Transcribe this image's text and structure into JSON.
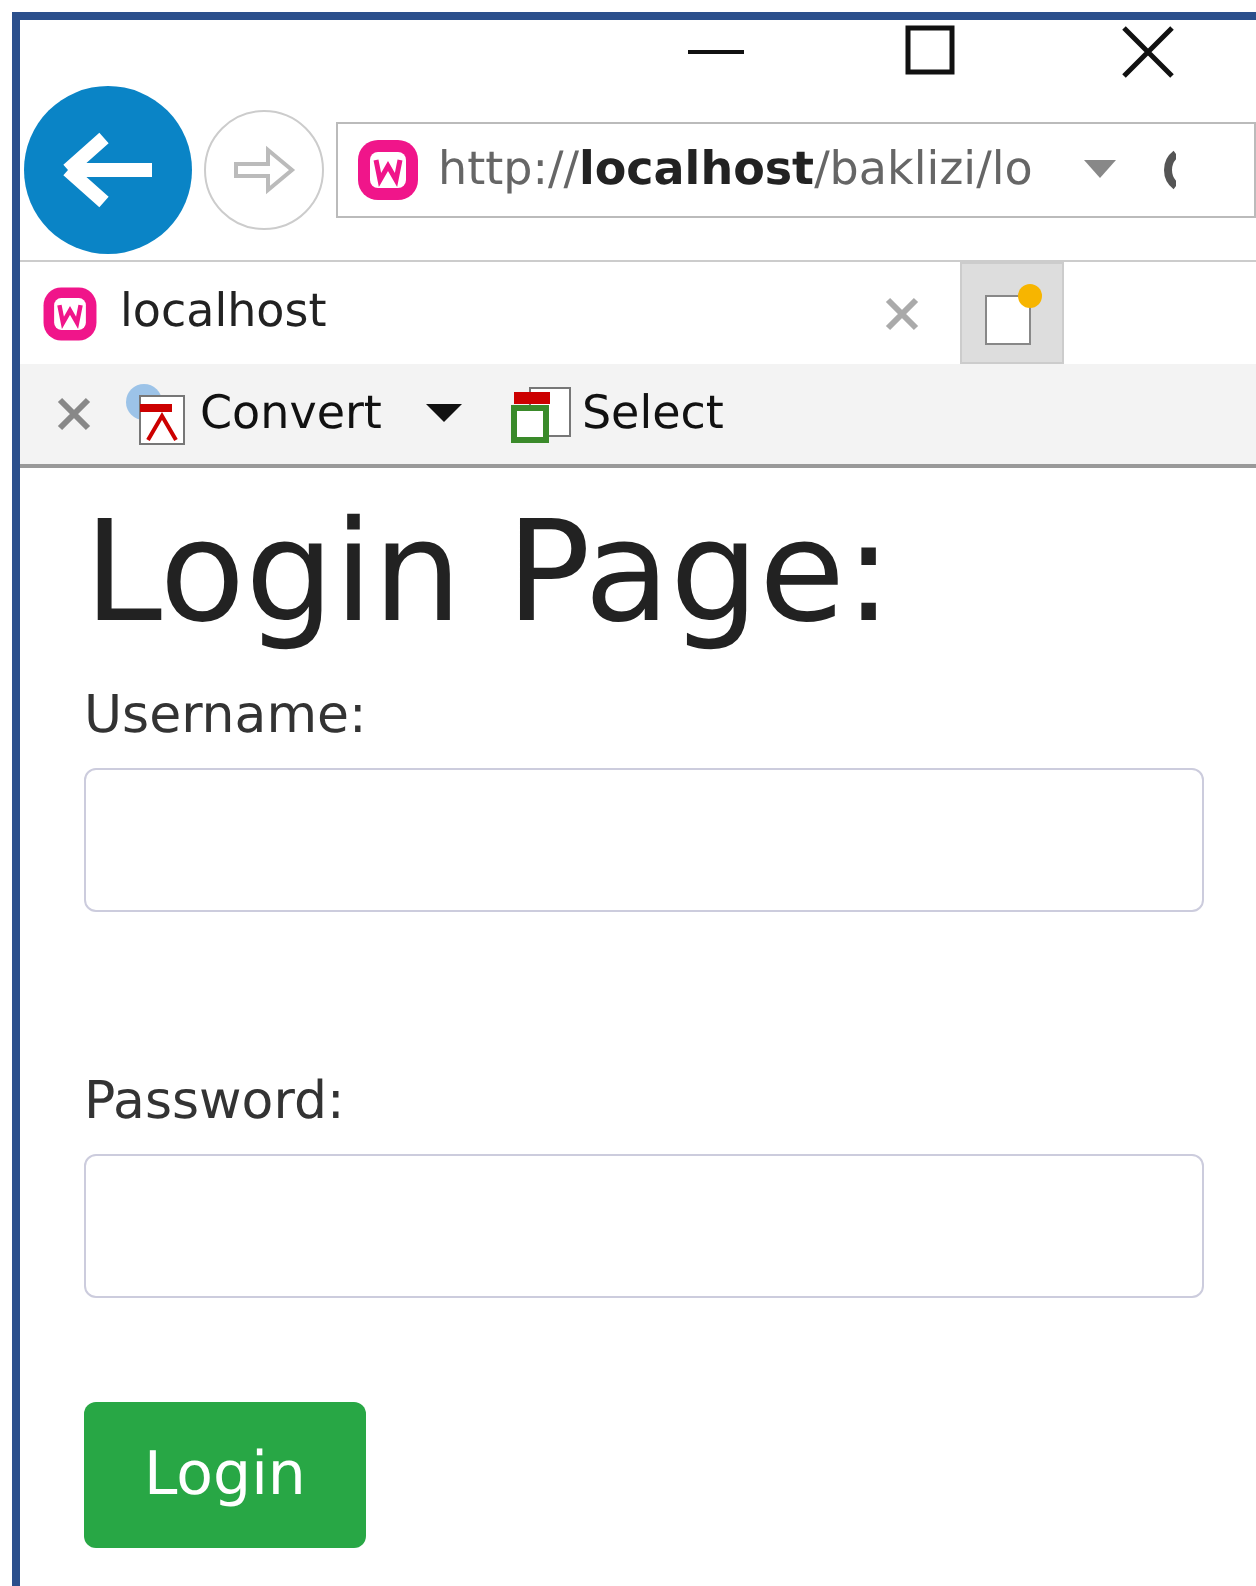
{
  "address_bar": {
    "url": "http://**localhost**/baklizi/lo"
  },
  "tabs": [
    {
      "title": "localhost",
      "selected": true
    }
  ],
  "toolbar": {
    "items": [
      {
        "label": "Convert",
        "kind": "convert"
      },
      {
        "label": "Select",
        "kind": "select"
      }
    ]
  },
  "page": {
    "heading": "Login Page:",
    "fields": [
      {
        "label": "Username:"
      },
      {
        "label": "Password:"
      }
    ],
    "button": "Login"
  }
}
